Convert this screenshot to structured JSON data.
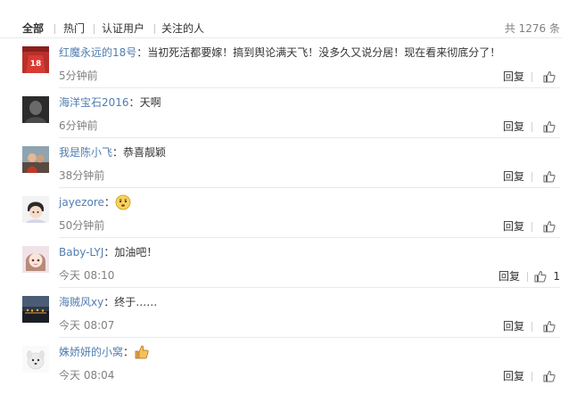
{
  "tabs": [
    {
      "label": "全部"
    },
    {
      "label": "热门"
    },
    {
      "label": "认证用户"
    },
    {
      "label": "关注的人"
    }
  ],
  "total_label": "共 1276 条",
  "comments": [
    {
      "user": "红魔永远的18号",
      "text": "当初死活都要嫁！搞到舆论满天飞！没多久又说分居！现在看来彻底分了！",
      "time": "5分钟前",
      "reply": "回复",
      "likes": "",
      "avatar": "red-jersey-avatar"
    },
    {
      "user": "海洋宝石2016",
      "text": "天啊",
      "time": "6分钟前",
      "reply": "回复",
      "likes": "",
      "avatar": "dark-portrait-avatar"
    },
    {
      "user": "我是陈小飞",
      "text": "恭喜靓颖",
      "time": "38分钟前",
      "reply": "回复",
      "likes": "",
      "avatar": "photo-avatar"
    },
    {
      "user": "jayezore",
      "text": "",
      "emoji": "worried-face-emoji",
      "time": "50分钟前",
      "reply": "回复",
      "likes": "",
      "avatar": "cartoon-boy-avatar"
    },
    {
      "user": "Baby-LYJ",
      "text": "加油吧！",
      "time": "今天 08:10",
      "reply": "回复",
      "likes": "1",
      "avatar": "cartoon-girl-avatar"
    },
    {
      "user": "海贼风xy",
      "text": "终于……",
      "time": "今天 08:07",
      "reply": "回复",
      "likes": "",
      "avatar": "landscape-avatar"
    },
    {
      "user": "姝娇妍的小窝",
      "text": "",
      "emoji": "thumbs-up-emoji",
      "time": "今天 08:04",
      "reply": "回复",
      "likes": "",
      "avatar": "white-dog-avatar"
    }
  ],
  "colors": {
    "link": "#507daf",
    "text": "#333333",
    "muted": "#808080",
    "rule": "#eaeaea"
  }
}
